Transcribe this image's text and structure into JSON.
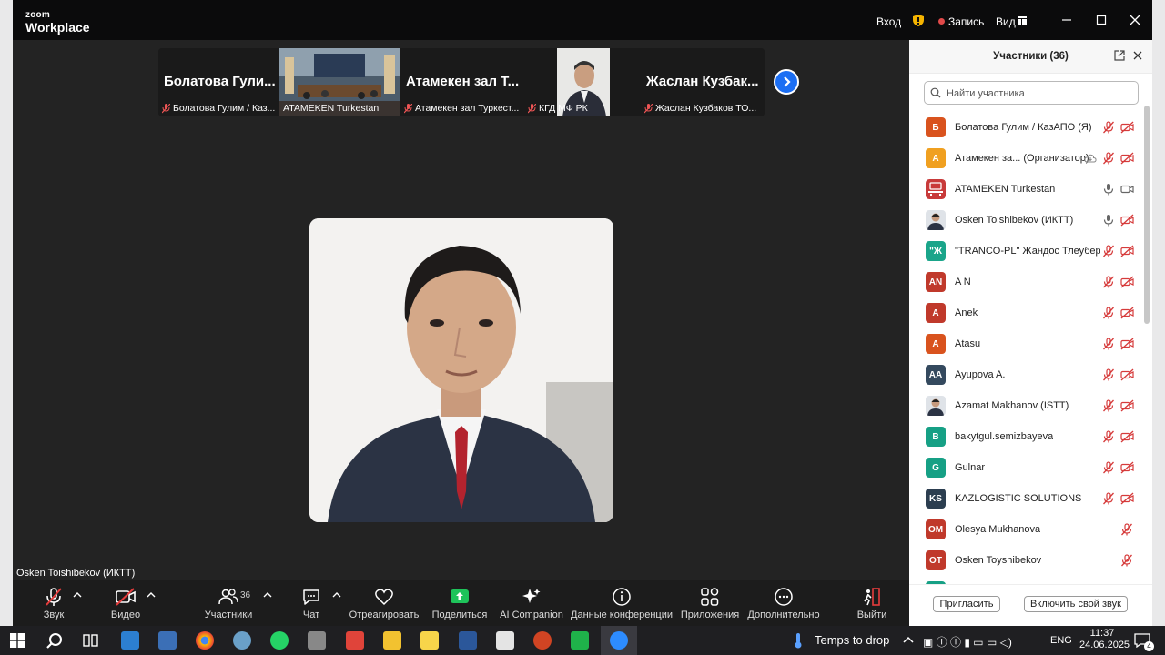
{
  "titlebar": {
    "logo_line1": "zoom",
    "logo_line2": "Workplace",
    "sign_in": "Вход",
    "recording": "Запись",
    "view": "Вид"
  },
  "gallery": {
    "tiles": [
      {
        "name": "Болатова Гули...",
        "footer": "Болатова Гулим / Каз..."
      },
      {
        "name": "",
        "footer": "ATAMEKEN Turkestan"
      },
      {
        "name": "Атамекен зал Т...",
        "footer": "Атамекен зал Туркест..."
      },
      {
        "name": "",
        "footer": "КГД МФ РК"
      },
      {
        "name": "Жаслан Кузбак...",
        "footer": "Жаслан Кузбаков ТО..."
      }
    ],
    "active_speaker": "Osken Toishibekov (ИКТТ)"
  },
  "toolbar": {
    "audio": "Звук",
    "video": "Видео",
    "participants": "Участники",
    "participants_count": "36",
    "chat": "Чат",
    "react": "Отреагировать",
    "share": "Поделиться",
    "ai": "AI Companion",
    "info": "Данные конференции",
    "apps": "Приложения",
    "more": "Дополнительно",
    "leave": "Выйти"
  },
  "panel": {
    "title": "Участники (36)",
    "search_placeholder": "Найти участника",
    "invite": "Пригласить",
    "unmute_self": "Включить свой звук",
    "participants": [
      {
        "initials": "Б",
        "name": "Болатова Гулим / КазАПО (Я)",
        "color": "#d9531e",
        "mic": "muted",
        "cam": "off"
      },
      {
        "initials": "А",
        "name": "Атамекен за... (Организатор)",
        "color": "#f0a020",
        "mic": "muted",
        "cam": "off",
        "cloud": true
      },
      {
        "initials": "",
        "name": "ATAMEKEN Turkestan",
        "color": "#c83a3a",
        "mic": "on",
        "cam": "on",
        "room": true
      },
      {
        "initials": "",
        "name": "Osken Toishibekov (ИКТТ)",
        "color": "#7a8aa0",
        "mic": "on",
        "cam": "off",
        "photo": true
      },
      {
        "initials": "\"Ж",
        "name": "\"TRANCO-PL\" Жандос Тлеуберг...",
        "color": "#1aa58a",
        "mic": "muted",
        "cam": "off"
      },
      {
        "initials": "AN",
        "name": "A N",
        "color": "#c0392b",
        "mic": "muted",
        "cam": "off"
      },
      {
        "initials": "A",
        "name": "Anek",
        "color": "#c0392b",
        "mic": "muted",
        "cam": "off"
      },
      {
        "initials": "A",
        "name": "Atasu",
        "color": "#d9531e",
        "mic": "muted",
        "cam": "off"
      },
      {
        "initials": "AA",
        "name": "Ayupova A.",
        "color": "#34495e",
        "mic": "muted",
        "cam": "off"
      },
      {
        "initials": "",
        "name": "Azamat Makhanov (ISTT)",
        "color": "#5b7a99",
        "mic": "muted",
        "cam": "off",
        "photo": true
      },
      {
        "initials": "B",
        "name": "bakytgul.semizbayeva",
        "color": "#16a085",
        "mic": "muted",
        "cam": "off"
      },
      {
        "initials": "G",
        "name": "Gulnar",
        "color": "#16a085",
        "mic": "muted",
        "cam": "off"
      },
      {
        "initials": "KS",
        "name": "KAZLOGISTIC SOLUTIONS",
        "color": "#2c3e50",
        "mic": "muted",
        "cam": "off"
      },
      {
        "initials": "OM",
        "name": "Olesya Mukhanova",
        "color": "#c0392b",
        "mic": "muted",
        "cam": "none"
      },
      {
        "initials": "OT",
        "name": "Osken Toyshibekov",
        "color": "#c0392b",
        "mic": "muted",
        "cam": "none"
      },
      {
        "initials": "",
        "name": "",
        "color": "#16a085",
        "mic": "muted",
        "cam": "off"
      }
    ]
  },
  "taskbar": {
    "weather": "Temps to drop",
    "lang": "ENG",
    "time": "11:37",
    "date": "24.06.2025",
    "notif_count": "4"
  }
}
